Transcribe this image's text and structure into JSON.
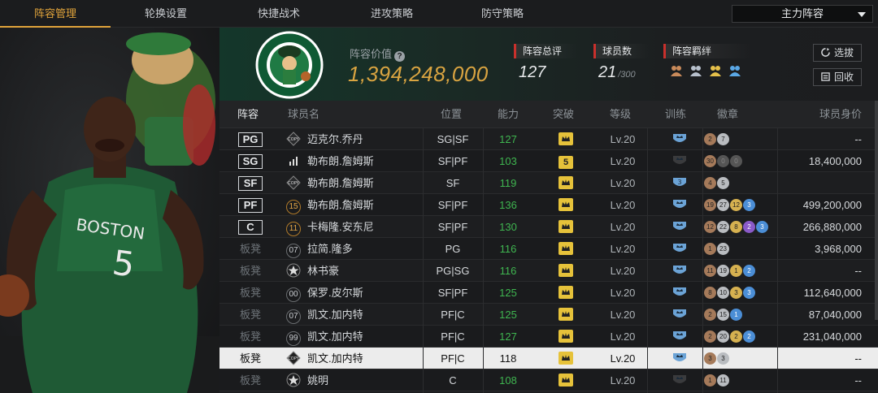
{
  "nav": {
    "tabs": [
      "阵容管理",
      "轮换设置",
      "快捷战术",
      "进攻策略",
      "防守策略"
    ],
    "active_tab": "阵容管理",
    "lineup_select": "主力阵容"
  },
  "header": {
    "team_logo": "boston-celtics-logo",
    "value_label": "阵容价值",
    "value": "1,394,248,000",
    "rating_label": "阵容总评",
    "rating": "127",
    "players_label": "球员数",
    "players": "21",
    "players_max": "/300",
    "bond_label": "阵容羁绊",
    "select_btn": "选拔",
    "recycle_btn": "回收"
  },
  "table": {
    "columns": [
      "阵容",
      "球员名",
      "位置",
      "能力",
      "突破",
      "等级",
      "训练",
      "徽章",
      "球员身价"
    ],
    "rows": [
      {
        "slot": "PG",
        "icon": "COPY",
        "name": "迈克尔.乔丹",
        "pos": "SG|SF",
        "ability": "127",
        "breakthrough": "crown",
        "level": "Lv.20",
        "training": "crown",
        "badges": [
          [
            "2",
            "b-bronze"
          ],
          [
            "7",
            "b-silver"
          ]
        ],
        "value": "--"
      },
      {
        "slot": "SG",
        "icon": "bars",
        "name": "勒布朗.詹姆斯",
        "pos": "SF|PF",
        "ability": "103",
        "breakthrough": "5",
        "level": "Lv.20",
        "training": "none",
        "badges": [
          [
            "30",
            "b-bronze"
          ],
          [
            "0",
            "b-gray"
          ],
          [
            "0",
            "b-gray"
          ]
        ],
        "value": "18,400,000"
      },
      {
        "slot": "SF",
        "icon": "COPY",
        "name": "勒布朗.詹姆斯",
        "pos": "SF",
        "ability": "119",
        "breakthrough": "crown",
        "level": "Lv.20",
        "training": "3",
        "badges": [
          [
            "4",
            "b-bronze"
          ],
          [
            "5",
            "b-silver"
          ]
        ],
        "value": ""
      },
      {
        "slot": "PF",
        "icon": "15",
        "name": "勒布朗.詹姆斯",
        "pos": "SF|PF",
        "ability": "136",
        "breakthrough": "crown",
        "level": "Lv.20",
        "training": "crown",
        "badges": [
          [
            "19",
            "b-bronze"
          ],
          [
            "27",
            "b-silver"
          ],
          [
            "12",
            "b-gold"
          ],
          [
            "3",
            "b-blue"
          ]
        ],
        "value": "499,200,000"
      },
      {
        "slot": "C",
        "icon": "11",
        "name": "卡梅隆.安东尼",
        "pos": "SF|PF",
        "ability": "130",
        "breakthrough": "crown",
        "level": "Lv.20",
        "training": "crown",
        "badges": [
          [
            "12",
            "b-bronze"
          ],
          [
            "22",
            "b-silver"
          ],
          [
            "8",
            "b-gold"
          ],
          [
            "2",
            "b-purple"
          ],
          [
            "3",
            "b-blue"
          ]
        ],
        "value": "266,880,000"
      },
      {
        "slot": "板凳",
        "icon": "07",
        "name": "拉简.隆多",
        "pos": "PG",
        "ability": "116",
        "breakthrough": "crown",
        "level": "Lv.20",
        "training": "crown",
        "badges": [
          [
            "1",
            "b-bronze"
          ],
          [
            "23",
            "b-silver"
          ]
        ],
        "value": "3,968,000"
      },
      {
        "slot": "板凳",
        "icon": "star",
        "name": "林书豪",
        "pos": "PG|SG",
        "ability": "116",
        "breakthrough": "crown",
        "level": "Lv.20",
        "training": "crown",
        "badges": [
          [
            "11",
            "b-bronze"
          ],
          [
            "19",
            "b-silver"
          ],
          [
            "1",
            "b-gold"
          ],
          [
            "2",
            "b-blue"
          ]
        ],
        "value": "--"
      },
      {
        "slot": "板凳",
        "icon": "00",
        "name": "保罗.皮尔斯",
        "pos": "SF|PF",
        "ability": "125",
        "breakthrough": "crown",
        "level": "Lv.20",
        "training": "crown",
        "badges": [
          [
            "8",
            "b-bronze"
          ],
          [
            "10",
            "b-silver"
          ],
          [
            "3",
            "b-gold"
          ],
          [
            "3",
            "b-blue"
          ]
        ],
        "value": "112,640,000"
      },
      {
        "slot": "板凳",
        "icon": "07",
        "name": "凯文.加内特",
        "pos": "PF|C",
        "ability": "125",
        "breakthrough": "crown",
        "level": "Lv.20",
        "training": "crown",
        "badges": [
          [
            "2",
            "b-bronze"
          ],
          [
            "15",
            "b-silver"
          ],
          [
            "1",
            "b-blue"
          ]
        ],
        "value": "87,040,000"
      },
      {
        "slot": "板凳",
        "icon": "99",
        "name": "凯文.加内特",
        "pos": "PF|C",
        "ability": "127",
        "breakthrough": "crown",
        "level": "Lv.20",
        "training": "crown",
        "badges": [
          [
            "2",
            "b-bronze"
          ],
          [
            "20",
            "b-silver"
          ],
          [
            "2",
            "b-gold"
          ],
          [
            "2",
            "b-blue"
          ]
        ],
        "value": "231,040,000"
      },
      {
        "slot": "板凳",
        "icon": "COPY",
        "name": "凯文.加内特",
        "pos": "PF|C",
        "ability": "118",
        "breakthrough": "crown",
        "level": "Lv.20",
        "training": "crown",
        "badges": [
          [
            "3",
            "b-bronze"
          ],
          [
            "3",
            "b-silver"
          ]
        ],
        "value": "--",
        "selected": true
      },
      {
        "slot": "板凳",
        "icon": "star",
        "name": "姚明",
        "pos": "C",
        "ability": "108",
        "breakthrough": "crown",
        "level": "Lv.20",
        "training": "none",
        "badges": [
          [
            "1",
            "b-bronze"
          ],
          [
            "11",
            "b-silver"
          ]
        ],
        "value": "--"
      }
    ]
  },
  "colors": {
    "accent": "#e0a33b",
    "ability_green": "#3fb650",
    "value_gold": "#d9a441",
    "celtics_green": "#14372a"
  }
}
